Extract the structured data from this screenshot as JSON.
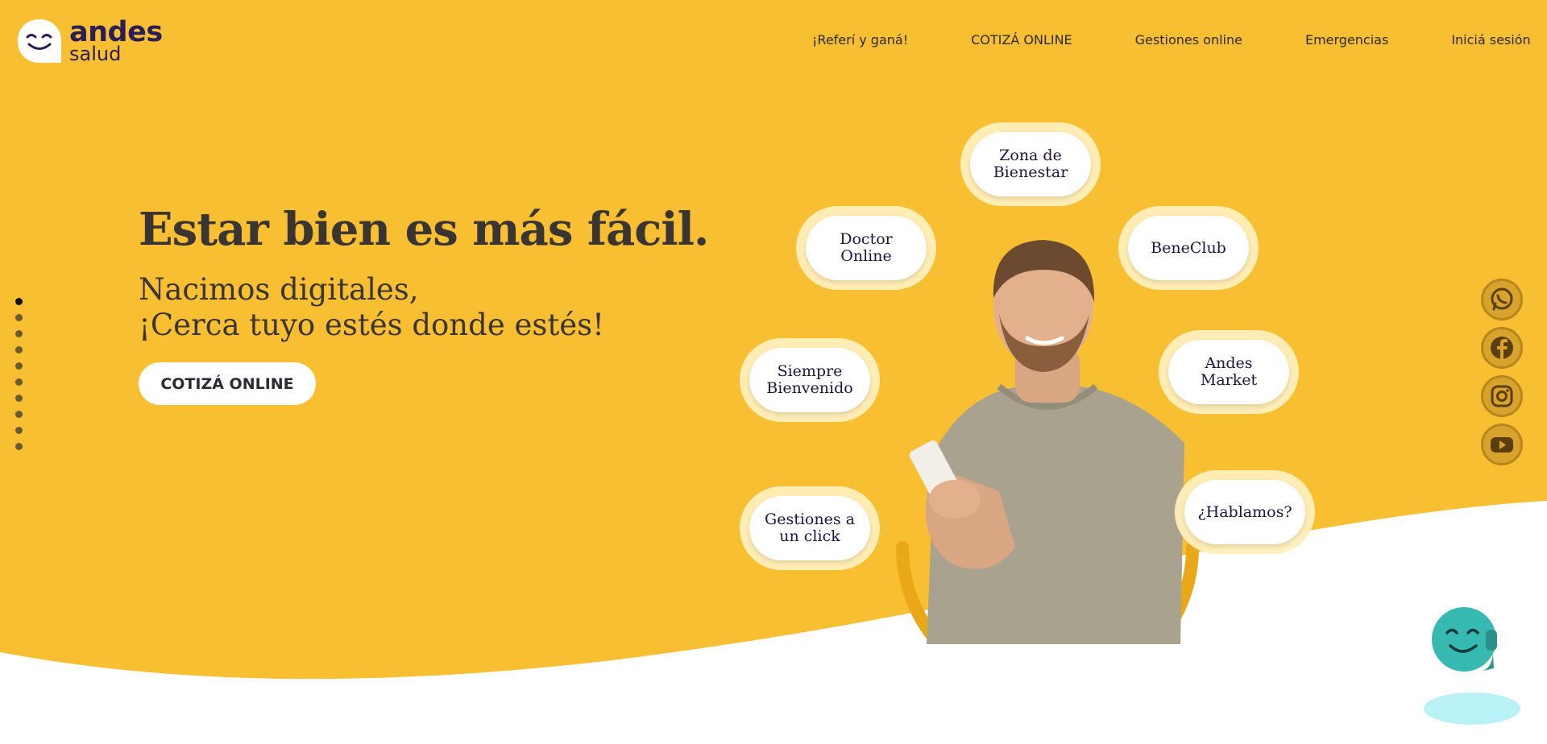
{
  "brand": {
    "name": "andes",
    "sub": "salud",
    "logo_icon": "smiley-face-icon",
    "colors": {
      "primary_yellow": "#f9bf32",
      "brand_purple": "#2b1d55",
      "text_dark": "#3a3533"
    }
  },
  "nav": {
    "items": [
      {
        "label": "¡Referí y ganá!"
      },
      {
        "label": "COTIZÁ ONLINE"
      },
      {
        "label": "Gestiones online"
      },
      {
        "label": "Emergencias"
      },
      {
        "label": "Iniciá sesión"
      }
    ]
  },
  "hero": {
    "title": "Estar bien es más fácil.",
    "subtitle_line1": "Nacimos digitales,",
    "subtitle_line2": "¡Cerca tuyo estés donde estés!",
    "cta_label": "COTIZÁ ONLINE"
  },
  "slider": {
    "total": 10,
    "active": 1
  },
  "bubbles": {
    "zona": "Zona de Bienestar",
    "doctor": "Doctor Online",
    "beneclub": "BeneClub",
    "siempre": "Siempre Bienvenido",
    "market": "Andes Market",
    "gestiones": "Gestiones a un click",
    "hablamos": "¿Hablamos?"
  },
  "social": {
    "icons": [
      "whatsapp-icon",
      "facebook-icon",
      "instagram-icon",
      "youtube-icon"
    ]
  },
  "chatbot": {
    "icon": "chatbot-icon"
  }
}
